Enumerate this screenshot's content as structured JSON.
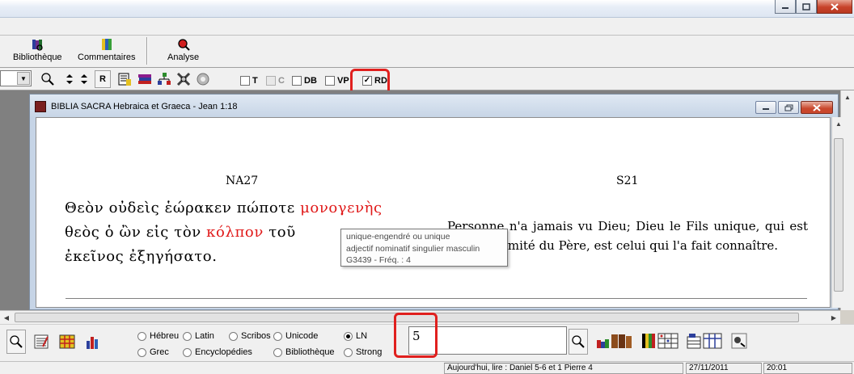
{
  "toolbar": {
    "bibliotheque": "Bibliothèque",
    "commentaires": "Commentaires",
    "analyse": "Analyse"
  },
  "small_toolbar": {
    "r_label": "R",
    "checks": [
      {
        "label": "T",
        "checked": false,
        "enabled": true
      },
      {
        "label": "C",
        "checked": false,
        "enabled": false
      },
      {
        "label": "DB",
        "checked": false,
        "enabled": true
      },
      {
        "label": "VP",
        "checked": false,
        "enabled": true
      },
      {
        "label": "RD",
        "checked": true,
        "enabled": true
      }
    ]
  },
  "document": {
    "title": "BIBLIA SACRA Hebraica et Graeca - Jean 1:18",
    "col_left_head": "NA27",
    "col_right_head": "S21",
    "greek": {
      "w1": "Θεὸν οὐδεὶς ἑώρακεν πώποτε ",
      "w2_red": "μονογενὴς",
      "w3": "θεὸς ὁ ὢν εἰς τὸν ",
      "w4_red": "κόλπον",
      "w5": " τοῦ",
      "w6": "ἐκεῖνος ἐξηγήσατο."
    },
    "french": "Personne n'a jamais vu Dieu; Dieu le Fils unique, qui est dans l'intimité du Père, est celui qui l'a fait connaître."
  },
  "tooltip": {
    "line1": "unique-engendré ou unique",
    "line2": "adjectif nominatif singulier masculin",
    "line3": "G3439 - Fréq. :  4"
  },
  "bottom": {
    "radios": {
      "hebreu": "Hébreu",
      "latin": "Latin",
      "scribos": "Scribos",
      "unicode": "Unicode",
      "ln": "LN",
      "grec": "Grec",
      "encyclopedies": "Encyclopédies",
      "bibliotheque": "Bibliothèque",
      "strong": "Strong"
    },
    "selected": "LN",
    "search_value": "5"
  },
  "status": {
    "reading": "Aujourd'hui, lire : Daniel 5-6 et 1 Pierre 4",
    "date": "27/11/2011",
    "time": "20:01"
  },
  "colors": {
    "highlight": "#e0201e",
    "greek_red": "#e01818"
  }
}
